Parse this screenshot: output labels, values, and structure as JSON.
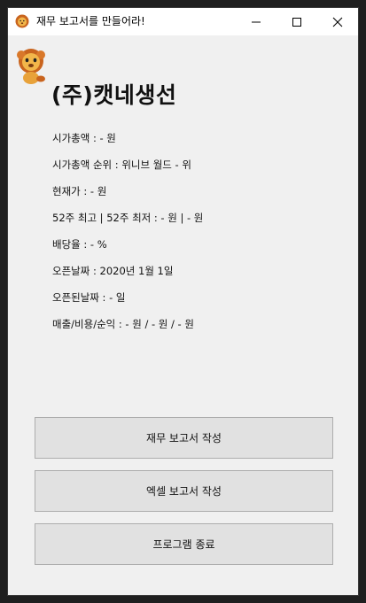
{
  "window": {
    "title": "재무 보고서를 만들어라!",
    "minimize_label": "minimize",
    "maximize_label": "maximize",
    "close_label": "close"
  },
  "icons": {
    "app": "lion-face-icon",
    "mascot": "lion-mascot-icon",
    "minimize": "minimize-icon",
    "maximize": "maximize-icon",
    "close": "close-icon"
  },
  "company": {
    "name": "(주)캣네생선"
  },
  "info": [
    "시가총액 : - 원",
    "시가총액 순위 : 위니브 월드 - 위",
    "현재가 : - 원",
    "52주 최고 | 52주 최저 : - 원 | - 원",
    "배당율 : - %",
    "오픈날짜 : 2020년 1월 1일",
    "오픈된날짜 : - 일",
    "매출/비용/순익 : - 원 / - 원 / - 원"
  ],
  "buttons": {
    "report": "재무 보고서 작성",
    "excel": "엑셀 보고서 작성",
    "exit": "프로그램 종료"
  },
  "colors": {
    "window_bg": "#f0f0f0",
    "button_bg": "#e1e1e1",
    "button_border": "#adadad",
    "lion_orange": "#e8a23a",
    "lion_mane": "#c9641e"
  }
}
